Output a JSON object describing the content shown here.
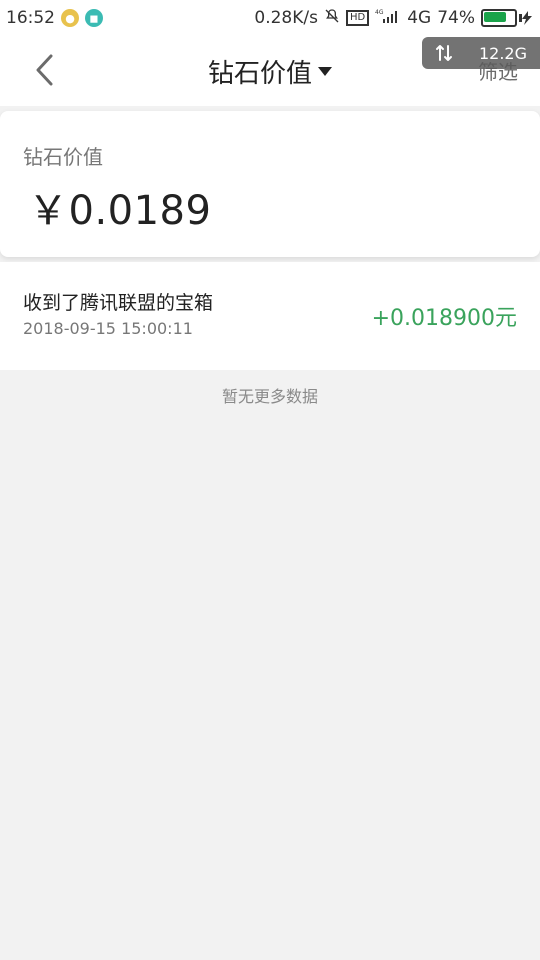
{
  "status_bar": {
    "time": "16:52",
    "network_speed": "0.28K/s",
    "network_type": "4G",
    "battery_percent": "74%",
    "battery_level": 0.74,
    "hd": "HD",
    "small_4g": "4G"
  },
  "header": {
    "title": "钻石价值",
    "filter_label": "筛选"
  },
  "data_badge": {
    "text": "12.2G"
  },
  "summary": {
    "label": "钻石价值",
    "value": "￥0.0189"
  },
  "transactions": [
    {
      "title": "收到了腾讯联盟的宝箱",
      "time": "2018-09-15 15:00:11",
      "amount": "+0.018900元"
    }
  ],
  "footer": {
    "no_more_text": "暂无更多数据"
  },
  "colors": {
    "amount_green": "#3aa35c",
    "battery_green": "#1aa34a"
  }
}
